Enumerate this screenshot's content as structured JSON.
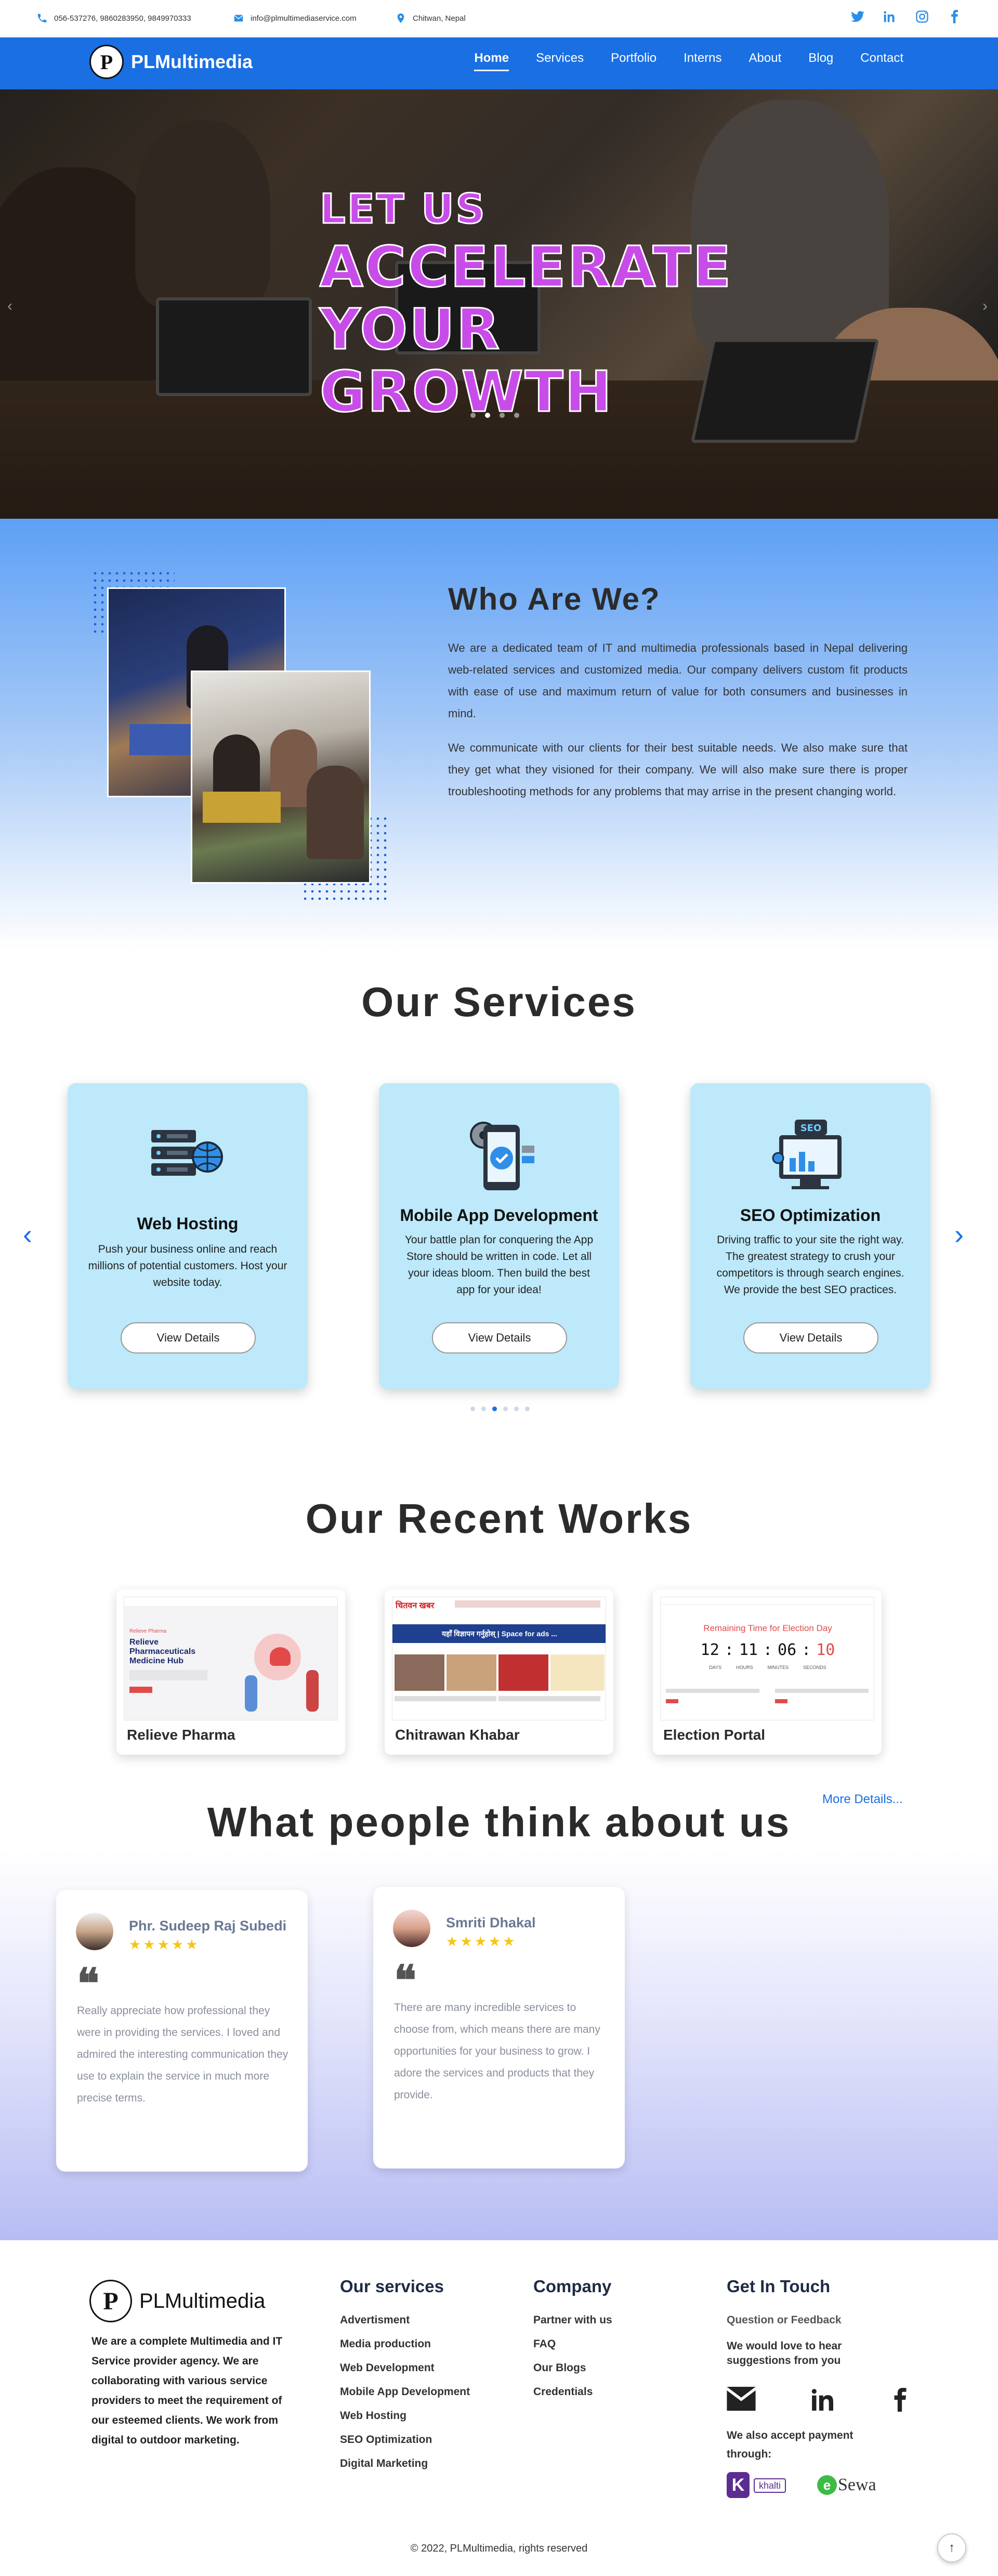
{
  "topbar": {
    "phone": "056-537276, 9860283950, 9849970333",
    "email": "info@plmultimediaservice.com",
    "location": "Chitwan, Nepal",
    "social_icons": [
      "twitter-icon",
      "linkedin-icon",
      "instagram-icon",
      "facebook-icon"
    ]
  },
  "brand": {
    "logo_letter": "P",
    "name": "PLMultimedia"
  },
  "nav": {
    "items": [
      "Home",
      "Services",
      "Portfolio",
      "Interns",
      "About",
      "Blog",
      "Contact"
    ],
    "active": "Home"
  },
  "hero": {
    "line1": "LET US",
    "line2": "ACCELERATE",
    "line3": "YOUR",
    "line4": "GROWTH",
    "slide_count": 4,
    "active_slide": 2
  },
  "about": {
    "title": "Who Are We?",
    "p1": "We are a dedicated team of IT and multimedia professionals based in Nepal delivering web-related services and customized media. Our company delivers custom fit products with ease of use and maximum return of value for both consumers and businesses in mind.",
    "p2": "We communicate with our clients for their best suitable needs. We also make sure that they get what they visioned for their company. We will also make sure there is proper troubleshooting methods for any problems that may arrise in the present changing world."
  },
  "services": {
    "title": "Our Services",
    "cards": [
      {
        "icon": "server-globe-icon",
        "title": "Web Hosting",
        "text": "Push your business online and reach millions of potential customers. Host your website today.",
        "button": "View Details"
      },
      {
        "icon": "mobile-app-icon",
        "title": "Mobile App Development",
        "text": "Your battle plan for conquering the App Store should be written in code. Let all your ideas bloom. Then build the best app for your idea!",
        "button": "View Details"
      },
      {
        "icon": "seo-monitor-icon",
        "title": "SEO Optimization",
        "text": "Driving traffic to your site the right way. The greatest strategy to crush your competitors is through search engines. We provide the best SEO practices.",
        "button": "View Details"
      }
    ],
    "page_count": 6,
    "active_page": 3
  },
  "works": {
    "title": "Our Recent Works",
    "items": [
      {
        "name": "Relieve Pharma",
        "shot": {
          "kicker": "Relieve Pharma",
          "headline": "Relieve Pharmaceuticals Medicine Hub"
        }
      },
      {
        "name": "Chitrawan Khabar",
        "shot": {
          "masthead": "चितवन खबर",
          "banner": "यहाँ विज्ञापन गर्नुहोस् | Space for ads ..."
        }
      },
      {
        "name": "Election Portal",
        "shot": {
          "heading": "Remaining Time for Election Day",
          "days": "12",
          "hours": "11",
          "minutes": "06",
          "seconds": "10",
          "labels": [
            "DAYS",
            "HOURS",
            "MINUTES",
            "SECONDS"
          ]
        }
      }
    ],
    "more": "More Details..."
  },
  "testimonials": {
    "title": "What people think about us",
    "items": [
      {
        "name": "Phr. Sudeep Raj Subedi",
        "stars": "★★★★★",
        "quote_mark": "❝",
        "text": "Really appreciate how professional they were in providing the services. I loved and admired the interesting communication they use to explain the service in much more precise terms."
      },
      {
        "name": "Smriti Dhakal",
        "stars": "★★★★★",
        "quote_mark": "❝",
        "text": "There are many incredible services to choose from, which means there are many opportunities for your business to grow. I adore the services and products that they provide."
      }
    ]
  },
  "footer": {
    "brand": "PLMultimedia",
    "description": "We are a complete Multimedia and IT Service provider agency. We are collaborating with various service providers to meet the requirement of our esteemed clients. We work from digital to outdoor marketing.",
    "services_title": "Our services",
    "services": [
      "Advertisment",
      "Media production",
      "Web Development",
      "Mobile App Development",
      "Web Hosting",
      "SEO Optimization",
      "Digital Marketing"
    ],
    "company_title": "Company",
    "company": [
      "Partner with us",
      "FAQ",
      "Our Blogs",
      "Credentials"
    ],
    "contact_title": "Get In Touch",
    "contact_sub": "Question or Feedback",
    "contact_text": "We would love to hear suggestions from you",
    "social_icons": [
      "mail-icon",
      "linkedin-icon",
      "facebook-icon"
    ],
    "payment_text": "We also accept payment through:",
    "payments": [
      "khalti",
      "Sewa"
    ],
    "copyright": "2022, PLMultimedia, rights reserved",
    "copyright_symbol": "©",
    "to_top": "↑"
  },
  "colors": {
    "brand_blue": "#1a6fe3",
    "hero_text": "#c84de8",
    "service_card": "#bde9fb",
    "star": "#f5c518"
  }
}
